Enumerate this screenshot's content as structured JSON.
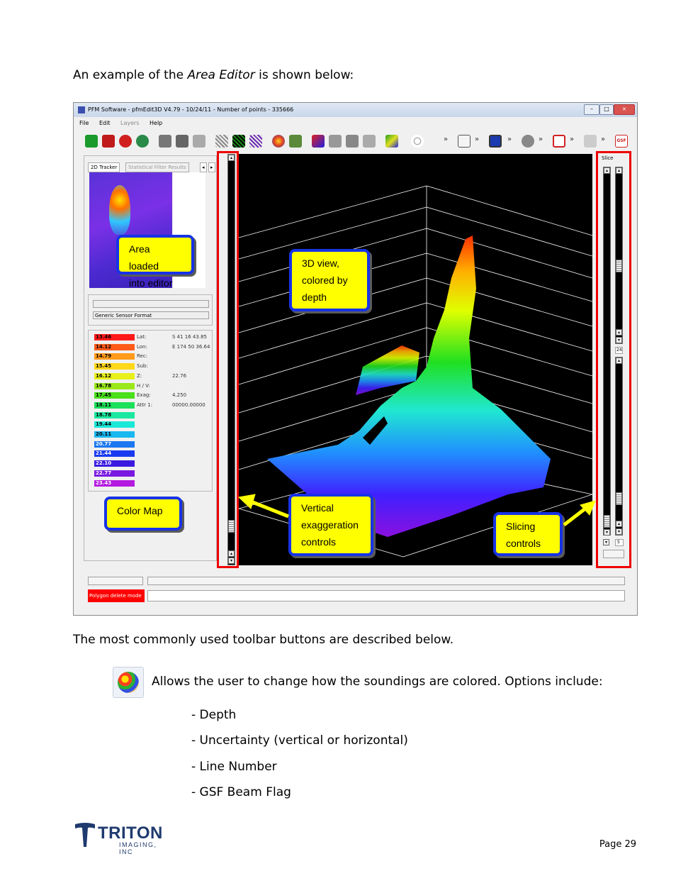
{
  "intro": {
    "prefix": "An example of the ",
    "emph": "Area Editor",
    "suffix": " is shown below:"
  },
  "window": {
    "title": "PFM Software - pfmEdit3D V4.79 - 10/24/11 - Number of points - 335666",
    "menu": [
      "File",
      "Edit",
      "Layers",
      "Help"
    ],
    "toolbar_more": "»",
    "tabs": [
      "2D Tracker",
      "Statistical Filter Results"
    ],
    "sensor_format": "Generic Sensor Format",
    "slice_label": "Slice",
    "slice_value_top": "24",
    "slice_value_bottom": "5",
    "status_mode": "Polygon delete mode",
    "colormap": [
      {
        "value": "13.46",
        "color": "#ff1a1a"
      },
      {
        "value": "14.12",
        "color": "#ff5a1a"
      },
      {
        "value": "14.79",
        "color": "#ff9a1a"
      },
      {
        "value": "15.45",
        "color": "#ffd81a"
      },
      {
        "value": "16.12",
        "color": "#e8f01a"
      },
      {
        "value": "16.78",
        "color": "#9ae81a"
      },
      {
        "value": "17.45",
        "color": "#4ae01a"
      },
      {
        "value": "18.11",
        "color": "#1ae05a"
      },
      {
        "value": "18.78",
        "color": "#1ae8a0"
      },
      {
        "value": "19.44",
        "color": "#1ae8d8"
      },
      {
        "value": "20.11",
        "color": "#1ab8f0"
      },
      {
        "value": "20.77",
        "color": "#1a78f0"
      },
      {
        "value": "21.44",
        "color": "#1a3af0"
      },
      {
        "value": "22.10",
        "color": "#3a1ae0"
      },
      {
        "value": "22.77",
        "color": "#7a1ae0"
      },
      {
        "value": "23.43",
        "color": "#b41ae0"
      }
    ],
    "readout": [
      {
        "key": "Lat:",
        "value": "S 41 16 43.85"
      },
      {
        "key": "Lon:",
        "value": "E 174 50 36.64"
      },
      {
        "key": "Rec:",
        "value": ""
      },
      {
        "key": "Sub:",
        "value": ""
      },
      {
        "key": "Z:",
        "value": "22.76"
      },
      {
        "key": "H / V:",
        "value": ""
      },
      {
        "key": "Exag:",
        "value": "4.250"
      },
      {
        "key": "Attr 1:",
        "value": "00000.00000"
      }
    ]
  },
  "callouts": {
    "area": "Area loaded\ninto editor",
    "view3d": "3D view,\ncolored by\ndepth",
    "colormap": "Color Map",
    "vertical": "Vertical\nexaggeration\ncontrols",
    "slicing": "Slicing\ncontrols"
  },
  "toolbar_desc": "The most commonly used toolbar buttons are described below.",
  "color_button_desc": "Allows the user to change how the soundings are colored.  Options include:",
  "options": [
    "- Depth",
    "- Uncertainty (vertical or horizontal)",
    "- Line Number",
    "- GSF Beam Flag"
  ],
  "logo": {
    "name": "TRITON",
    "sub": "IMAGING, INC"
  },
  "page_number": "Page 29",
  "colors": {
    "callout_fill": "#ffff00",
    "callout_border": "#1733e6",
    "highlight_red": "#e00000"
  }
}
